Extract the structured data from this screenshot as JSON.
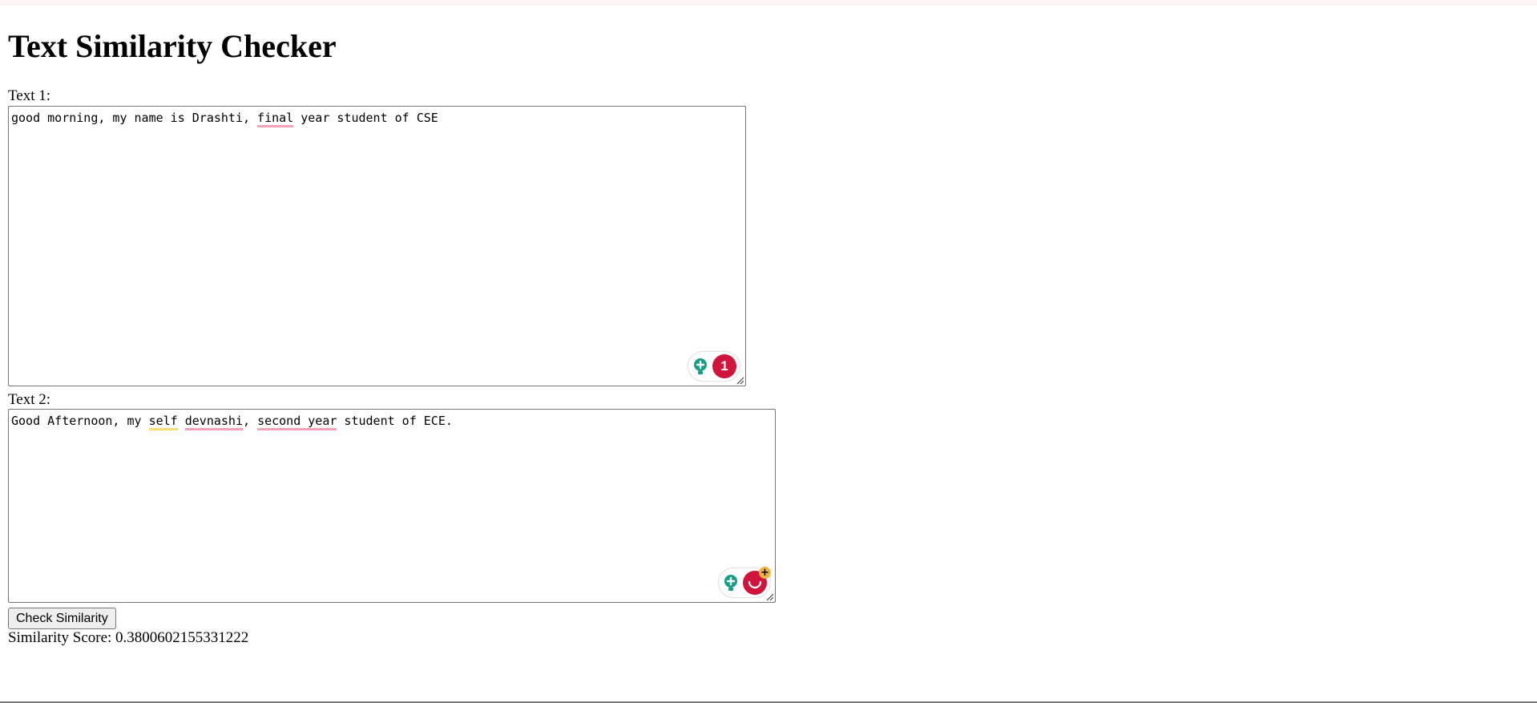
{
  "page": {
    "title": "Text Similarity Checker"
  },
  "text1": {
    "label": "Text 1:",
    "segments": [
      {
        "text": "good morning, my name is Drashti, ",
        "underline": ""
      },
      {
        "text": "final",
        "underline": "red"
      },
      {
        "text": " year student of CSE",
        "underline": ""
      }
    ],
    "assistant_badge": "1"
  },
  "text2": {
    "label": "Text 2:",
    "segments": [
      {
        "text": "Good Afternoon, my ",
        "underline": ""
      },
      {
        "text": "self",
        "underline": "yellow"
      },
      {
        "text": " ",
        "underline": ""
      },
      {
        "text": "devnashi",
        "underline": "red"
      },
      {
        "text": ", ",
        "underline": ""
      },
      {
        "text": "second year",
        "underline": "red"
      },
      {
        "text": " student of ECE.",
        "underline": ""
      }
    ],
    "assistant_badge_plus": "+"
  },
  "actions": {
    "check_label": "Check Similarity"
  },
  "result": {
    "label": "Similarity Score: 0.3800602155331222"
  },
  "colors": {
    "spelling_underline": "#f6a0b3",
    "style_underline": "#f5dd74",
    "assistant_badge": "#d0153d",
    "assistant_bulb": "#15a085"
  },
  "icons": {
    "suggestion": "lightbulb-icon",
    "issues": "issues-badge-icon",
    "resize": "resize-grip-icon"
  }
}
